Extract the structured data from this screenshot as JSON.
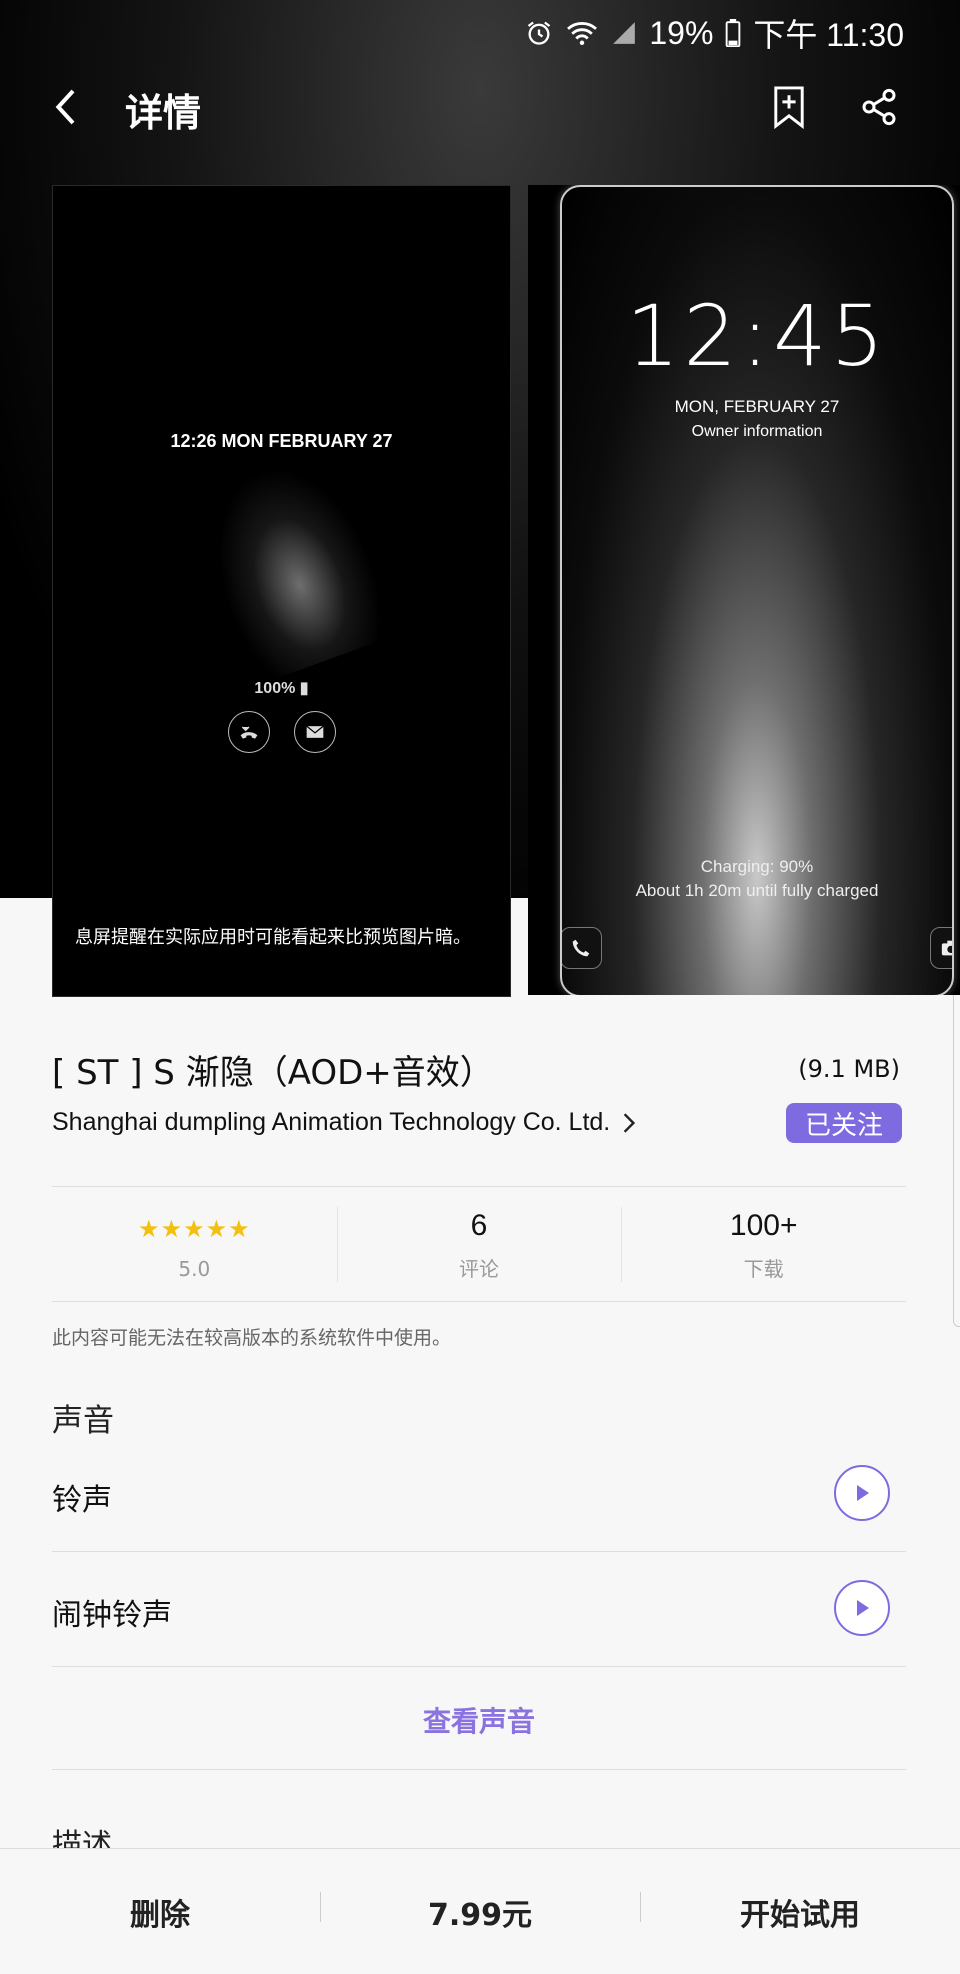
{
  "status_bar": {
    "battery_percent": "19%",
    "time": "下午 11:30"
  },
  "header": {
    "title": "详情"
  },
  "preview1": {
    "time_date": "12:26  MON FEBRUARY 27",
    "battery": "100%",
    "caption": "息屏提醒在实际应用时可能看起来比预览图片暗。"
  },
  "preview2": {
    "clock": "12:45",
    "date": "MON, FEBRUARY 27",
    "owner": "Owner information",
    "charging": "Charging: 90%",
    "full_charge": "About 1h 20m until fully charged"
  },
  "app": {
    "title": "[ ST ] S 渐隐（AOD+音效）",
    "size": "(9.1 MB)",
    "publisher": "Shanghai dumpling Animation Technology Co. Ltd.",
    "follow_label": "已关注",
    "rating_value": 5.0
  },
  "stats": {
    "rating": "5.0",
    "reviews_count": "6",
    "reviews_label": "评论",
    "downloads_count": "100+",
    "downloads_label": "下载"
  },
  "notice": "此内容可能无法在较高版本的系统软件中使用。",
  "sound": {
    "section_title": "声音",
    "items": [
      {
        "label": "铃声"
      },
      {
        "label": "闹钟铃声"
      }
    ],
    "view_all": "查看声音"
  },
  "description_title": "描述",
  "bottom_bar": {
    "delete": "删除",
    "price": "7.99元",
    "trial": "开始试用"
  },
  "colors": {
    "accent": "#7e6be0",
    "star": "#f3c010"
  }
}
